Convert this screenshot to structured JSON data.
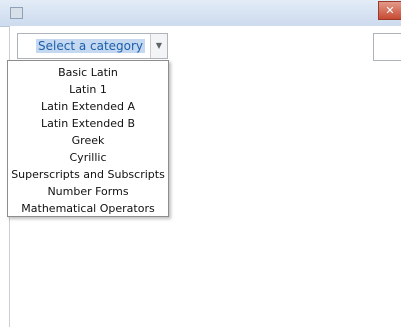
{
  "combo": {
    "selected_label": "Select a category",
    "arrow_glyph": "▼"
  },
  "window": {
    "close_glyph": "✕"
  },
  "dropdown": {
    "items": [
      "Basic Latin",
      "Latin 1",
      "Latin Extended A",
      "Latin Extended B",
      "Greek",
      "Cyrillic",
      "Superscripts and Subscripts",
      "Number Forms",
      "Mathematical Operators"
    ]
  },
  "colors": {
    "selection_bg": "#c4d9f1",
    "selection_text": "#1c5ea8",
    "close_button": "#c74a32"
  }
}
